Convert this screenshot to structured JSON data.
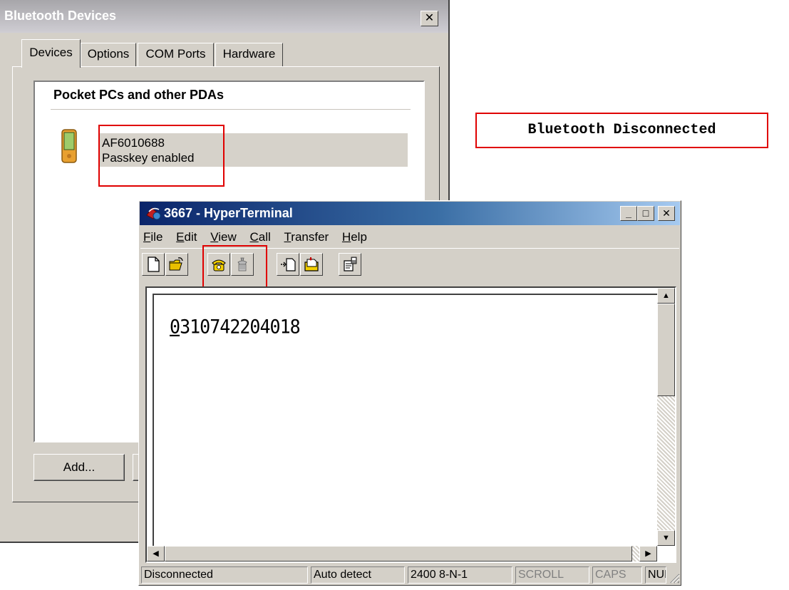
{
  "bt_dialog": {
    "title": "Bluetooth Devices",
    "close_glyph": "✕",
    "tabs": [
      "Devices",
      "Options",
      "COM Ports",
      "Hardware"
    ],
    "group_header": "Pocket PCs and other PDAs",
    "device": {
      "name": "AF6010688",
      "status": "Passkey enabled",
      "icon": "pda-icon"
    },
    "add_button": "Add..."
  },
  "callout": {
    "text": "Bluetooth Disconnected",
    "border_color": "#e00000"
  },
  "hyperterminal": {
    "title": "3667 - HyperTerminal",
    "menu": [
      {
        "accel": "F",
        "rest": "ile"
      },
      {
        "accel": "E",
        "rest": "dit"
      },
      {
        "accel": "V",
        "rest": "iew"
      },
      {
        "accel": "C",
        "rest": "all"
      },
      {
        "accel": "T",
        "rest": "ransfer"
      },
      {
        "accel": "H",
        "rest": "elp"
      }
    ],
    "toolbar_icons": [
      "new-icon",
      "open-icon",
      "call-icon",
      "disconnect-icon",
      "send-icon",
      "receive-icon",
      "properties-icon"
    ],
    "terminal": {
      "cursor_char": "0",
      "text_rest": "310742204018"
    },
    "status": {
      "connection": "Disconnected",
      "detect": "Auto detect",
      "port_settings": "2400 8-N-1",
      "scroll": "SCROLL",
      "caps": "CAPS",
      "num": "NUM"
    },
    "title_bar_colors": [
      "#0a246a",
      "#a6caf0"
    ]
  }
}
